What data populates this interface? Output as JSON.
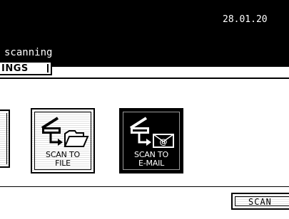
{
  "header": {
    "date": "28.01.20",
    "title": "scanning",
    "tab_label": "INGS"
  },
  "buttons": {
    "scan_to_file": {
      "line1": "SCAN TO",
      "line2": "FILE"
    },
    "scan_to_email": {
      "line1": "SCAN TO",
      "line2": "E-MAIL"
    }
  },
  "footer": {
    "scan_button_label": "SCAN"
  },
  "colors": {
    "header_bg": "#000000",
    "selected_bg": "#000000",
    "text_on_dark": "#ffffff"
  }
}
